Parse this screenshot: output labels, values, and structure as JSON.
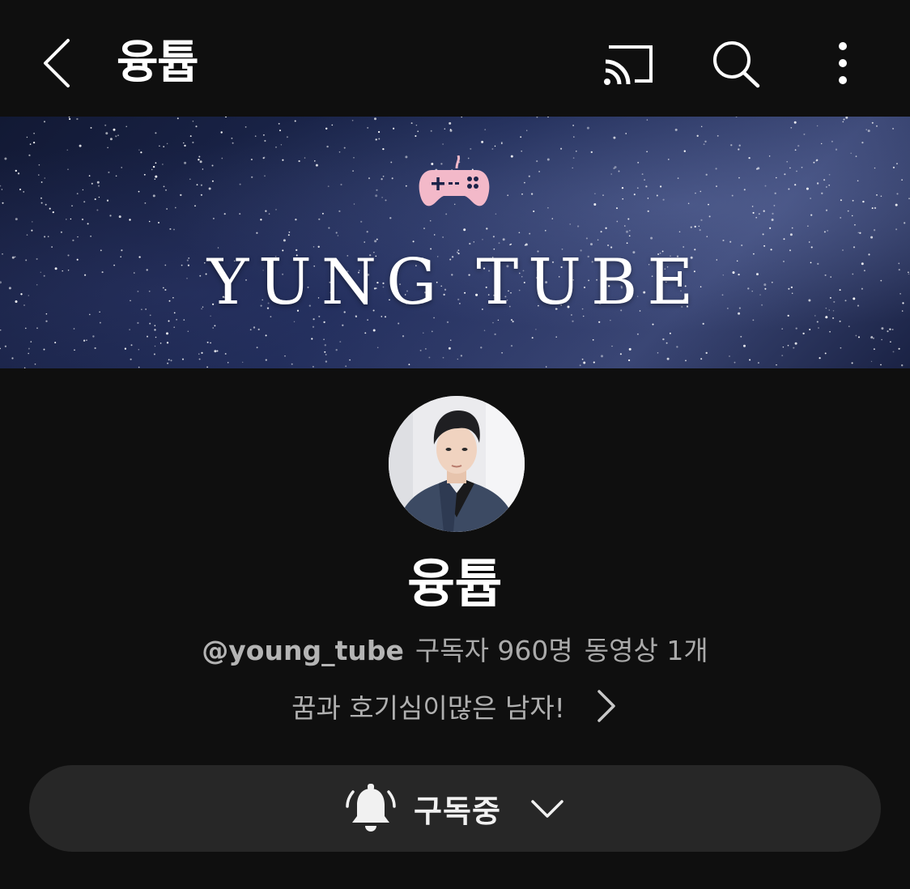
{
  "header": {
    "title": "융튭",
    "back_icon": "chevron-left-icon",
    "cast_icon": "cast-icon",
    "search_icon": "search-icon",
    "more_icon": "more-vertical-icon"
  },
  "banner": {
    "brand_text": "YUNG TUBE",
    "logo_icon": "gamepad-icon",
    "logo_color": "#f3b9c9"
  },
  "channel": {
    "name": "융튭",
    "handle": "@young_tube",
    "subscribers": "구독자 960명",
    "videos": "동영상 1개",
    "description": "꿈과 호기심이많은 남자!"
  },
  "subscribe": {
    "label": "구독중",
    "bell_icon": "bell-icon",
    "dropdown_icon": "chevron-down-icon"
  }
}
